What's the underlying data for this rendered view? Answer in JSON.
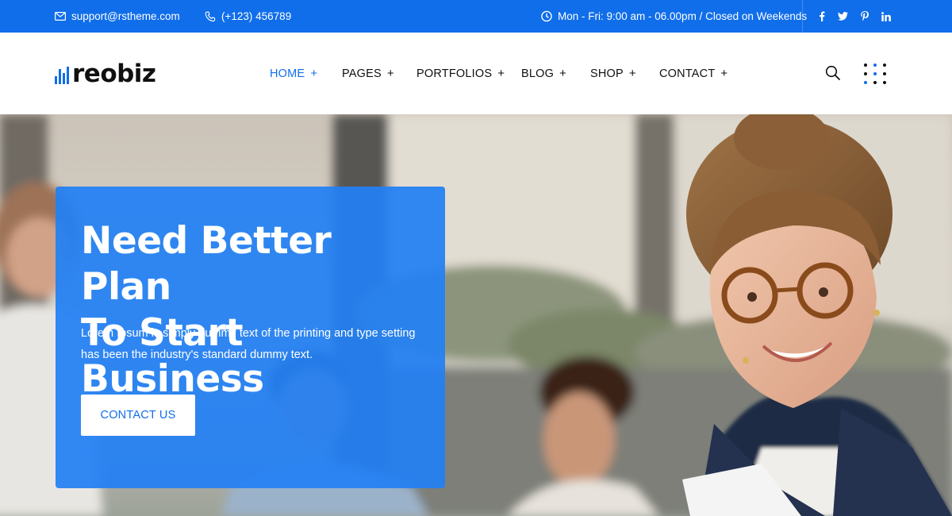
{
  "topbar": {
    "email": "support@rstheme.com",
    "phone": "(+123) 456789",
    "hours": "Mon - Fri: 9:00 am - 06.00pm / Closed on Weekends",
    "social": [
      {
        "icon": "facebook-icon",
        "glyph": "f"
      },
      {
        "icon": "twitter-icon",
        "glyph": ""
      },
      {
        "icon": "pinterest-icon",
        "glyph": ""
      },
      {
        "icon": "linkedin-icon",
        "glyph": "in"
      }
    ]
  },
  "header": {
    "logo_text": "reobiz",
    "nav": [
      {
        "label": "HOME",
        "plus": "+",
        "active": true
      },
      {
        "label": "PAGES",
        "plus": "+"
      },
      {
        "label": "PORTFOLIOS",
        "plus": "+"
      },
      {
        "label": "BLOG",
        "plus": "+"
      },
      {
        "label": "SHOP",
        "plus": "+"
      },
      {
        "label": "CONTACT",
        "plus": "+"
      }
    ]
  },
  "hero": {
    "title_line1": "Need Better Plan",
    "title_line2": "To Start Business",
    "description": "Lorem Ipsum is simply dummy text of the printing and type setting has been the industry's standard dummy text.",
    "button_label": "CONTACT US"
  },
  "colors": {
    "brand_blue": "#106eea",
    "card_blue": "#2280f4",
    "text_dark": "#101010"
  }
}
